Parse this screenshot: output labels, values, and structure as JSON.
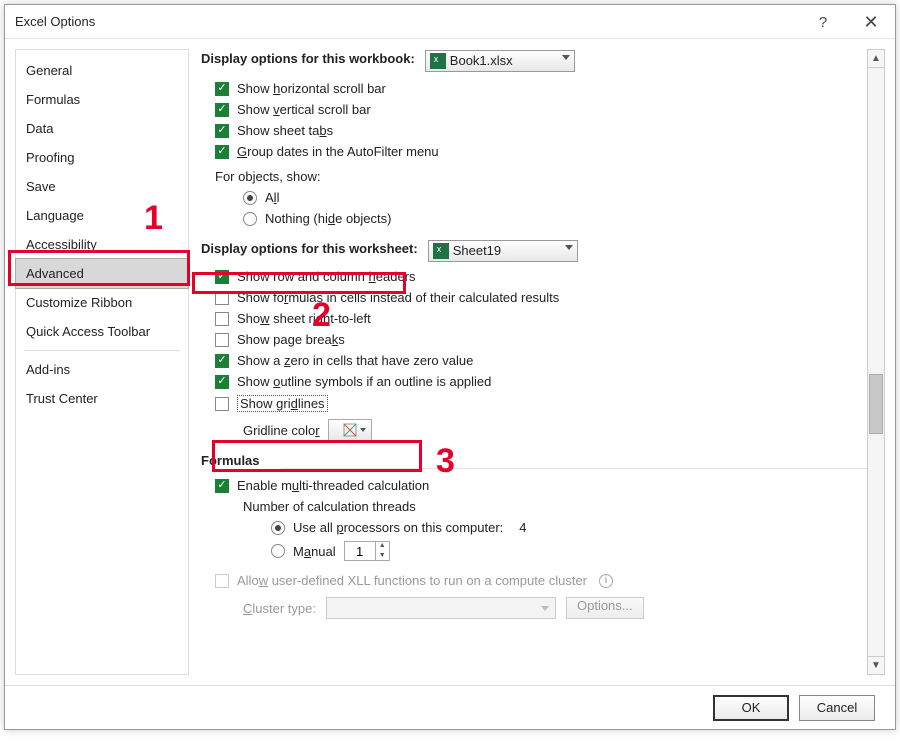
{
  "window": {
    "title": "Excel Options",
    "help_label": "?",
    "close_label": "✕"
  },
  "sidebar": {
    "items": [
      {
        "label": "General"
      },
      {
        "label": "Formulas"
      },
      {
        "label": "Data"
      },
      {
        "label": "Proofing"
      },
      {
        "label": "Save"
      },
      {
        "label": "Language"
      },
      {
        "label": "Accessibility"
      },
      {
        "label": "Advanced",
        "active": true
      },
      {
        "label": "Customize Ribbon"
      },
      {
        "label": "Quick Access Toolbar"
      },
      {
        "label": "Add-ins"
      },
      {
        "label": "Trust Center"
      }
    ]
  },
  "sections": {
    "workbook": {
      "header": "Display options for this workbook:",
      "dropdown_value": "Book1.xlsx",
      "opts": [
        {
          "label": "Show horizontal scroll bar",
          "checked": true,
          "ul": "h"
        },
        {
          "label": "Show vertical scroll bar",
          "checked": true,
          "ul": "v"
        },
        {
          "label": "Show sheet tabs",
          "checked": true,
          "ul": "b"
        },
        {
          "label": "Group dates in the AutoFilter menu",
          "checked": true,
          "ul": "G"
        }
      ],
      "objects_label": "For objects, show:",
      "objects_all": "All",
      "objects_nothing": "Nothing (hide objects)"
    },
    "worksheet": {
      "header": "Display options for this worksheet:",
      "dropdown_value": "Sheet19",
      "opts": [
        {
          "label": "Show row and column headers",
          "checked": true
        },
        {
          "label": "Show formulas in cells instead of their calculated results",
          "checked": false
        },
        {
          "label": "Show sheet right-to-left",
          "checked": false
        },
        {
          "label": "Show page breaks",
          "checked": false
        },
        {
          "label": "Show a zero in cells that have zero value",
          "checked": true
        },
        {
          "label": "Show outline symbols if an outline is applied",
          "checked": true
        },
        {
          "label": "Show gridlines",
          "checked": false
        }
      ],
      "gridline_color_label": "Gridline color"
    },
    "formulas": {
      "header": "Formulas",
      "enable": "Enable multi-threaded calculation",
      "threads_label": "Number of calculation threads",
      "use_all": "Use all processors on this computer:",
      "processor_count": "4",
      "manual": "Manual",
      "manual_value": "1",
      "allow_xll": "Allow user-defined XLL functions to run on a compute cluster",
      "cluster_type": "Cluster type:",
      "options_btn": "Options..."
    }
  },
  "footer": {
    "ok": "OK",
    "cancel": "Cancel"
  },
  "annotations": {
    "n1": "1",
    "n2": "2",
    "n3": "3"
  }
}
